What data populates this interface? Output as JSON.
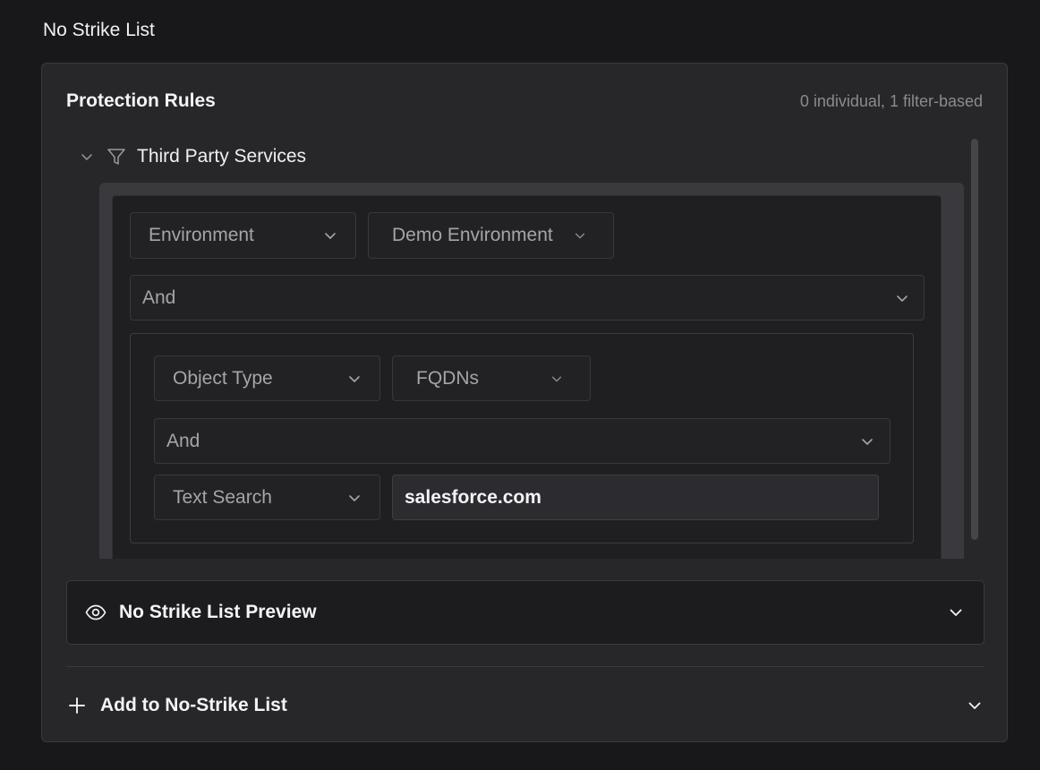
{
  "page": {
    "title": "No Strike List"
  },
  "panel": {
    "title": "Protection Rules",
    "count": "0 individual, 1 filter-based"
  },
  "rule": {
    "name": "Third Party Services",
    "icons": {
      "toggle": "chevron-down-icon",
      "type": "filter-icon"
    },
    "field_select": "Environment",
    "value_select": "Demo Environment",
    "operator_select": "And",
    "group": {
      "field_select": "Object Type",
      "value_select": "FQDNs",
      "operator_select": "And",
      "search_field_select": "Text Search",
      "search_value": "salesforce.com"
    }
  },
  "preview": {
    "label": "No Strike List Preview",
    "icon": "eye-icon"
  },
  "add": {
    "label": "Add to No-Strike List",
    "icon": "plus-icon"
  },
  "colors": {
    "background": "#18181b",
    "panel": "#27272a",
    "text": "#f4f4f6",
    "muted": "#8a8a90"
  }
}
